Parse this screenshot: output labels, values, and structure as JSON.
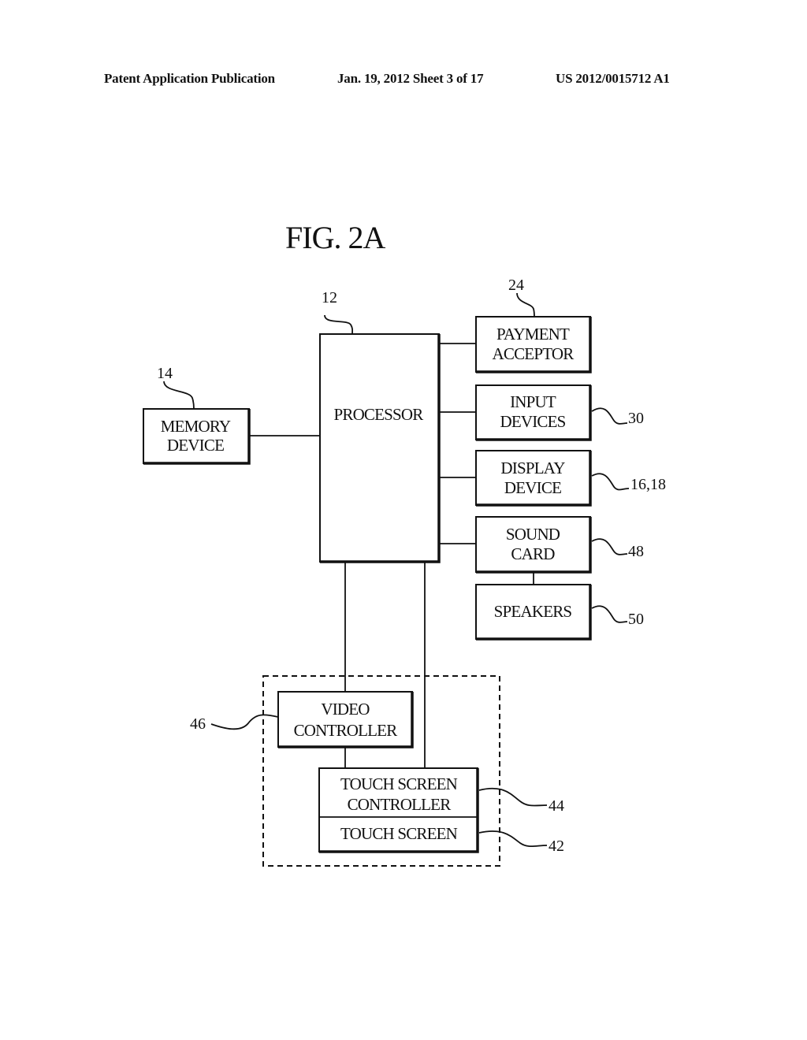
{
  "header": {
    "publication": "Patent Application Publication",
    "date_sheet": "Jan. 19, 2012  Sheet 3 of 17",
    "patent_number": "US 2012/0015712 A1"
  },
  "figure": {
    "title": "FIG. 2A",
    "blocks": {
      "processor": {
        "line1": "PROCESSOR",
        "ref": "12"
      },
      "memory": {
        "line1": "MEMORY",
        "line2": "DEVICE",
        "ref": "14"
      },
      "payment": {
        "line1": "PAYMENT",
        "line2": "ACCEPTOR",
        "ref": "24"
      },
      "input": {
        "line1": "INPUT",
        "line2": "DEVICES",
        "ref": "30"
      },
      "display": {
        "line1": "DISPLAY",
        "line2": "DEVICE",
        "ref": "16,18"
      },
      "sound": {
        "line1": "SOUND",
        "line2": "CARD",
        "ref": "48"
      },
      "speakers": {
        "line1": "SPEAKERS",
        "ref": "50"
      },
      "video": {
        "line1": "VIDEO",
        "line2": "CONTROLLER",
        "ref": "46"
      },
      "ts_controller": {
        "line1": "TOUCH SCREEN",
        "line2": "CONTROLLER",
        "ref": "44"
      },
      "touch_screen": {
        "line1": "TOUCH SCREEN",
        "ref": "42"
      }
    }
  }
}
